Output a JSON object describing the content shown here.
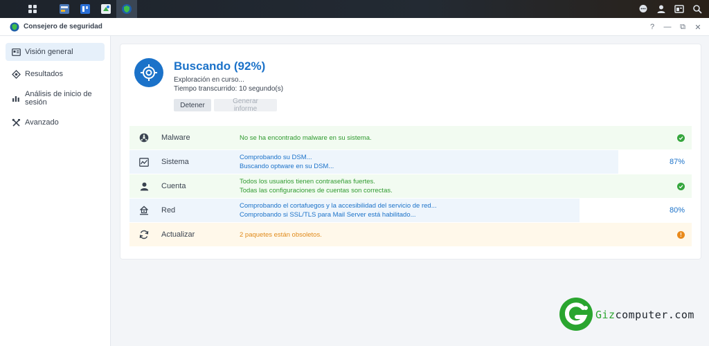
{
  "window": {
    "title": "Consejero de seguridad",
    "controls": {
      "help": "?",
      "minimize": "—",
      "restore": "⧉",
      "close": "✕"
    }
  },
  "sidebar": {
    "items": [
      {
        "label": "Visión general",
        "icon": "overview-icon",
        "active": true
      },
      {
        "label": "Resultados",
        "icon": "results-icon",
        "active": false
      },
      {
        "label": "Análisis de inicio de sesión",
        "icon": "chart-icon",
        "active": false
      },
      {
        "label": "Avanzado",
        "icon": "tools-icon",
        "active": false
      }
    ]
  },
  "scan": {
    "title": "Buscando (92%)",
    "progress_percent": 92,
    "status_line1": "Exploración en curso...",
    "status_line2": "Tiempo transcurrido: 10 segundo(s)",
    "stop_label": "Detener",
    "report_label": "Generar informe"
  },
  "categories": [
    {
      "name": "Malware",
      "icon": "biohazard-icon",
      "state": "ok",
      "lines": [
        "No se ha encontrado malware en su sistema."
      ],
      "status": ""
    },
    {
      "name": "Sistema",
      "icon": "system-icon",
      "state": "progress",
      "lines": [
        "Comprobando su DSM...",
        "Buscando optware en su DSM..."
      ],
      "status": "87%",
      "progress_percent": 87
    },
    {
      "name": "Cuenta",
      "icon": "user-icon",
      "state": "ok",
      "lines": [
        "Todos los usuarios tienen contraseñas fuertes.",
        "Todas las configuraciones de cuentas son correctas."
      ],
      "status": ""
    },
    {
      "name": "Red",
      "icon": "network-icon",
      "state": "progress",
      "lines": [
        "Comprobando el cortafuegos y la accesibilidad del servicio de red...",
        "Comprobando si SSL/TLS para Mail Server está habilitado..."
      ],
      "status": "80%",
      "progress_percent": 80
    },
    {
      "name": "Actualizar",
      "icon": "refresh-icon",
      "state": "warning",
      "lines": [
        "2 paquetes están obsoletos."
      ],
      "status": "!"
    }
  ],
  "watermark": {
    "text": "Gizcomputer.com"
  },
  "colors": {
    "accent": "#1b72c9",
    "ok": "#35a63d",
    "ok_text": "#2f9a2f",
    "warning": "#e98a1c",
    "watermark_green": "#2aa52f"
  }
}
